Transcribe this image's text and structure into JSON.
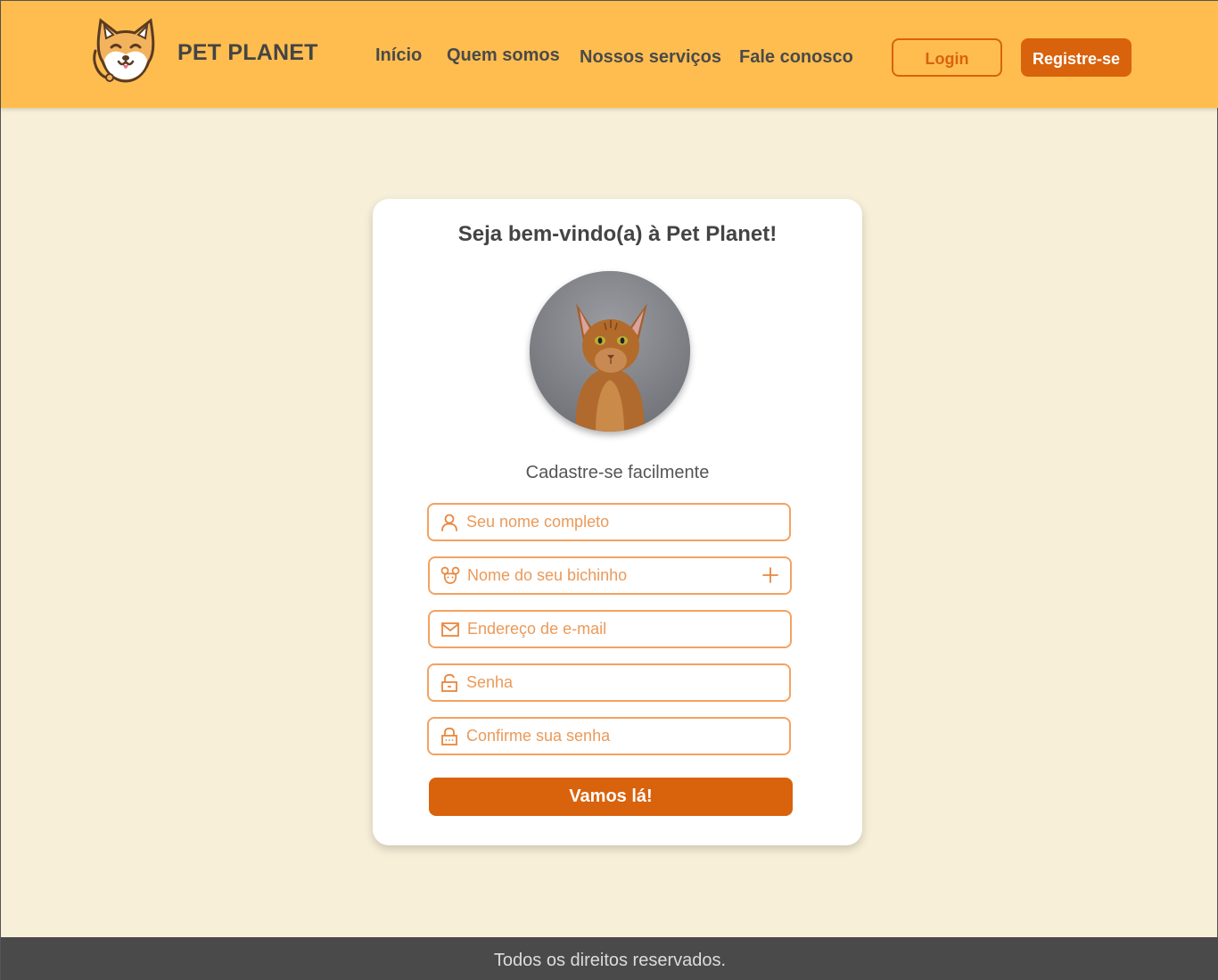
{
  "header": {
    "brand": "PET PLANET",
    "nav": [
      "Início",
      "Quem somos",
      "Nossos serviços",
      "Fale conosco"
    ],
    "login_label": "Login",
    "register_label": "Registre-se"
  },
  "card": {
    "title": "Seja bem-vindo(a) à Pet Planet!",
    "subtitle": "Cadastre-se facilmente",
    "fields": {
      "full_name": {
        "placeholder": "Seu nome completo",
        "icon": "user-icon"
      },
      "pet_name": {
        "placeholder": "Nome do seu bichinho",
        "icon": "paw-icon"
      },
      "email": {
        "placeholder": "Endereço de e-mail",
        "icon": "mail-icon"
      },
      "password": {
        "placeholder": "Senha",
        "icon": "unlock-icon"
      },
      "confirm_password": {
        "placeholder": "Confirme sua senha",
        "icon": "lock-icon"
      }
    },
    "submit_label": "Vamos lá!"
  },
  "footer": {
    "text": "Todos os direitos reservados."
  },
  "colors": {
    "header_bg": "#ffbd4f",
    "page_bg": "#f7efd8",
    "accent": "#d9620c",
    "field_border": "#f4a261",
    "footer_bg": "#4a4a4a"
  }
}
